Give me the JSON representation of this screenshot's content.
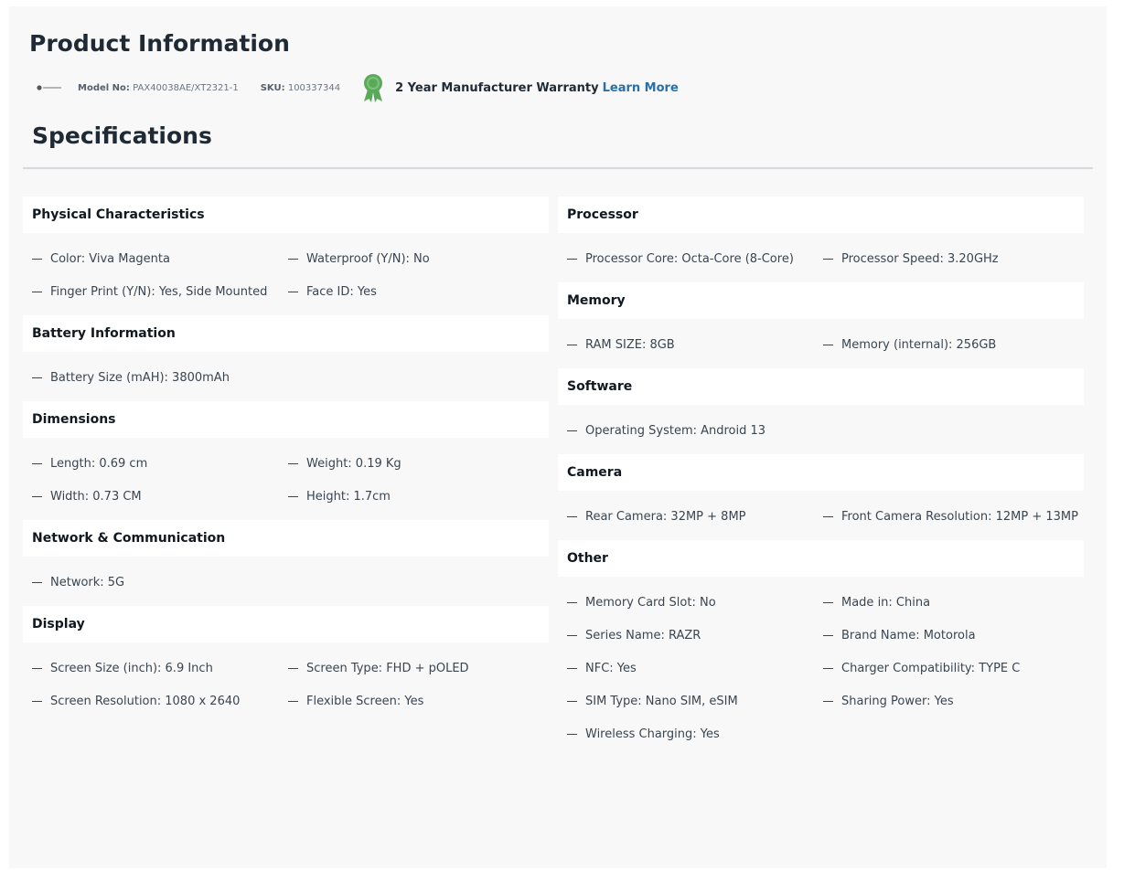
{
  "header": {
    "title": "Product Information",
    "model_label": "Model No:",
    "model_value": "PAX40038AE/XT2321-1",
    "sku_label": "SKU:",
    "sku_value": "100337344",
    "warranty_text": "2 Year Manufacturer Warranty",
    "warranty_link": "Learn More",
    "warranty_icon": "award-ribbon-icon"
  },
  "specs_title": "Specifications",
  "colors": {
    "accent_link": "#2a6fa8",
    "warranty_badge": "#5aa85a",
    "panel_bg": "#f8f8f8"
  },
  "left_groups": [
    {
      "title": "Physical Characteristics",
      "items": [
        "Color: Viva Magenta",
        "Waterproof (Y/N): No",
        "Finger Print (Y/N): Yes, Side Mounted",
        "Face ID: Yes"
      ]
    },
    {
      "title": "Battery Information",
      "items": [
        "Battery Size (mAH): 3800mAh"
      ]
    },
    {
      "title": "Dimensions",
      "items": [
        "Length: 0.69 cm",
        "Weight: 0.19 Kg",
        "Width: 0.73 CM",
        "Height: 1.7cm"
      ]
    },
    {
      "title": "Network & Communication",
      "items": [
        "Network: 5G"
      ]
    },
    {
      "title": "Display",
      "items": [
        "Screen Size (inch): 6.9 Inch",
        "Screen Type: FHD + pOLED",
        "Screen Resolution: 1080 x 2640",
        "Flexible Screen: Yes"
      ]
    }
  ],
  "right_groups": [
    {
      "title": "Processor",
      "items": [
        "Processor Core: Octa-Core (8-Core)",
        "Processor Speed: 3.20GHz"
      ]
    },
    {
      "title": "Memory",
      "items": [
        "RAM SIZE: 8GB",
        "Memory (internal): 256GB"
      ]
    },
    {
      "title": "Software",
      "items": [
        "Operating System: Android 13"
      ]
    },
    {
      "title": "Camera",
      "items": [
        "Rear Camera: 32MP + 8MP",
        "Front Camera Resolution: 12MP + 13MP"
      ]
    },
    {
      "title": "Other",
      "items": [
        "Memory Card Slot: No",
        "Made in: China",
        "Series Name: RAZR",
        "Brand Name: Motorola",
        "NFC: Yes",
        "Charger Compatibility: TYPE C",
        "SIM Type: Nano SIM, eSIM",
        "Sharing Power: Yes",
        "Wireless Charging: Yes"
      ]
    }
  ]
}
